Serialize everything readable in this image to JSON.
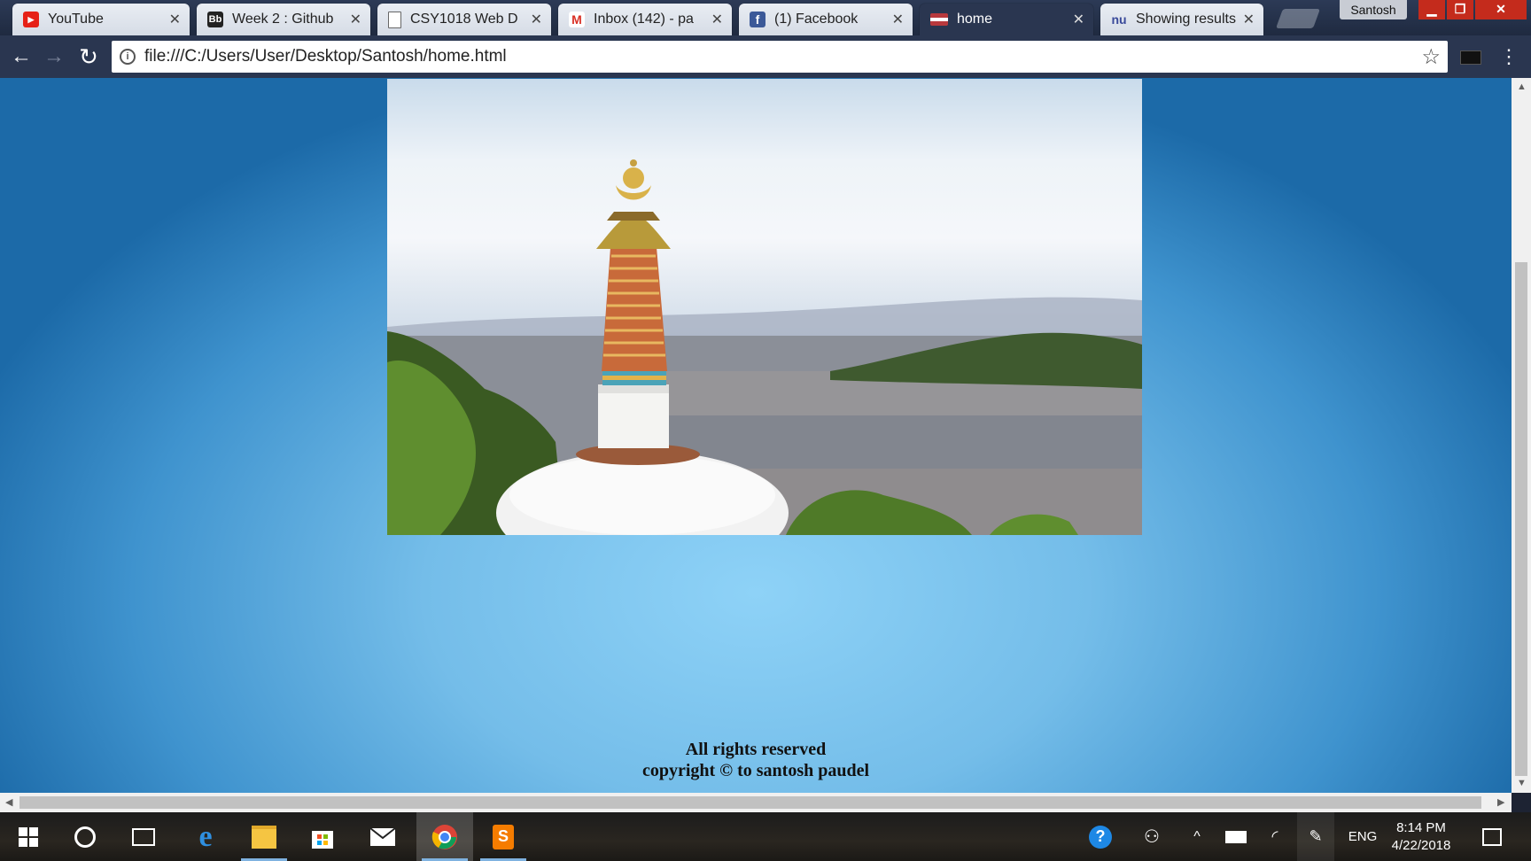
{
  "browser": {
    "tabs": [
      {
        "title": "YouTube",
        "icon": "youtube-icon",
        "active": false
      },
      {
        "title": "Week 2 : Github",
        "icon": "blackboard-icon",
        "active": false
      },
      {
        "title": "CSY1018 Web D",
        "icon": "document-icon",
        "active": false
      },
      {
        "title": "Inbox (142) - pa",
        "icon": "gmail-icon",
        "active": false
      },
      {
        "title": "(1) Facebook",
        "icon": "facebook-icon",
        "active": false
      },
      {
        "title": "home",
        "icon": "page-favicon-icon",
        "active": true
      },
      {
        "title": "Showing results",
        "icon": "nu-icon",
        "active": false
      }
    ],
    "profile_name": "Santosh",
    "url": "file:///C:/Users/User/Desktop/Santosh/home.html"
  },
  "page": {
    "footer_line1": "All rights reserved",
    "footer_line2": "copyright © to santosh paudel"
  },
  "taskbar": {
    "language": "ENG",
    "time": "8:14 PM",
    "date": "4/22/2018"
  },
  "colors": {
    "chrome_frame": "#2a3650",
    "page_bg_center": "#8ed2f7",
    "page_bg_edge": "#1c6aa8",
    "taskbar_open_indicator": "#7fb2e0"
  }
}
